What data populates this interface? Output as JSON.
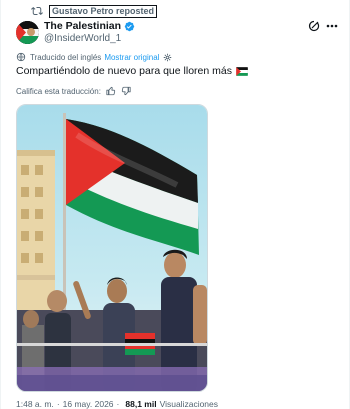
{
  "repost": {
    "text": "Gustavo Petro reposted"
  },
  "author": {
    "display_name": "The Palestinian",
    "handle": "@InsiderWorld_1",
    "verified": true
  },
  "translation": {
    "label": "Traducido del inglés",
    "show_original": "Mostrar original"
  },
  "tweet": {
    "text": "Compartiéndolo de nuevo para que lloren más"
  },
  "rate": {
    "label": "Califica esta traducción:"
  },
  "meta": {
    "time": "1:48 a. m.",
    "separator": "·",
    "date": "16 may. 2026",
    "views_count": "88,1 mil",
    "views_label": "Visualizaciones"
  },
  "icons": {
    "repost": "repost-icon",
    "verified": "verified-badge-icon",
    "grok": "grok-icon",
    "more": "more-icon",
    "translate": "translate-icon",
    "settings": "gear-icon",
    "like": "thumbs-up-icon",
    "dislike": "thumbs-down-icon",
    "flag": "palestine-flag-emoji"
  },
  "colors": {
    "accent": "#1d9bf0",
    "muted": "#536471",
    "text": "#0f1419",
    "flag_red": "#e4312b",
    "flag_green": "#149954"
  }
}
